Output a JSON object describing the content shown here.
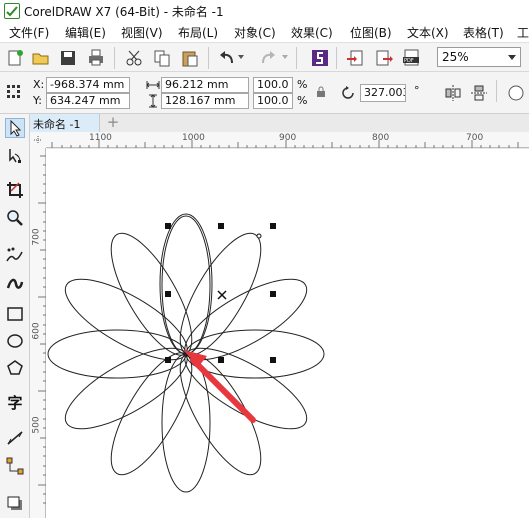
{
  "window": {
    "title": "CorelDRAW X7 (64-Bit) - 未命名 -1"
  },
  "menu": [
    "文件(F)",
    "编辑(E)",
    "视图(V)",
    "布局(L)",
    "对象(C)",
    "效果(C)",
    "位图(B)",
    "文本(X)",
    "表格(T)",
    "工"
  ],
  "toolbar": {
    "zoom": "25%"
  },
  "properties": {
    "x_label": "X:",
    "x_value": "-968.374 mm",
    "y_label": "Y:",
    "y_value": "634.247 mm",
    "width_value": "96.212 mm",
    "height_value": "128.167 mm",
    "scale_x": "100.0",
    "scale_y": "100.0",
    "percent_1": "%",
    "percent_2": "%",
    "rotation": "327.003",
    "degree": "°"
  },
  "tabs": {
    "document": "未命名 -1",
    "add": "+"
  },
  "ruler": {
    "h_ticks": [
      "1100",
      "1000",
      "900",
      "800",
      "700"
    ],
    "v_ticks": [
      "700",
      "600",
      "500"
    ]
  },
  "colors": {
    "accent_arrow": "#e8383d",
    "tab_active": "#dcebf8",
    "toolbar_bg": "#f4f4f4"
  },
  "icons": [
    "new-icon",
    "open-icon",
    "save-icon",
    "print-icon",
    "cut-icon",
    "copy-icon",
    "paste-icon",
    "undo-icon",
    "redo-icon",
    "app-launcher-icon",
    "import-icon",
    "export-icon",
    "pdf-icon"
  ]
}
